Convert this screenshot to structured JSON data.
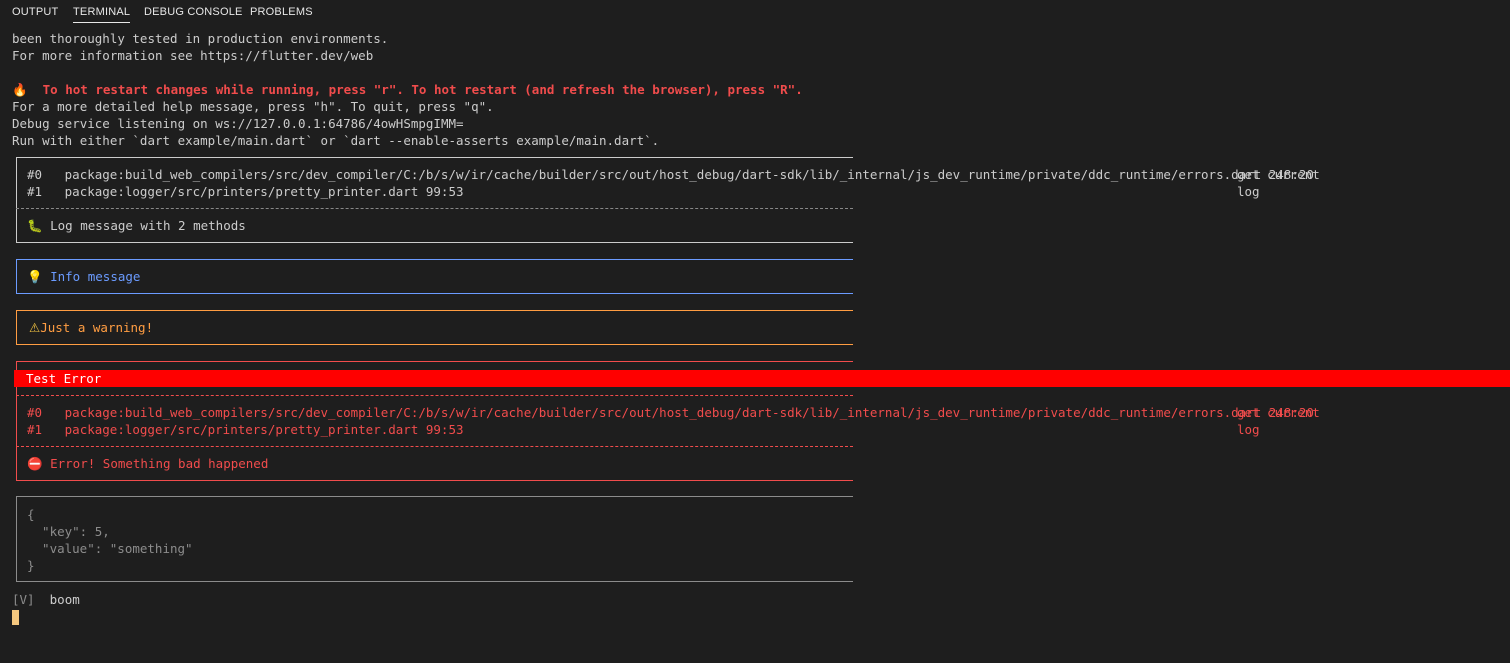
{
  "tabs": [
    {
      "label": "OUTPUT",
      "active": false
    },
    {
      "label": "TERMINAL",
      "active": true
    },
    {
      "label": "DEBUG CONSOLE",
      "active": false
    },
    {
      "label": "PROBLEMS",
      "active": false
    }
  ],
  "terminal": {
    "intro": [
      "been thoroughly tested in production environments.",
      "For more information see https://flutter.dev/web"
    ],
    "hot_restart": "To hot restart changes while running, press \"r\". To hot restart (and refresh the browser), press \"R\".",
    "help_lines": [
      "For a more detailed help message, press \"h\". To quit, press \"q\".",
      "Debug service listening on ws://127.0.0.1:64786/4owHSmpgIMM=",
      "Run with either `dart example/main.dart` or `dart --enable-asserts example/main.dart`."
    ],
    "debug_box": {
      "frames": [
        {
          "num": "#0",
          "path": "package:build_web_compilers/src/dev_compiler/C:/b/s/w/ir/cache/builder/src/out/host_debug/dart-sdk/lib/_internal/js_dev_runtime/private/ddc_runtime/errors.dart 248:20",
          "fn": "get current"
        },
        {
          "num": "#1",
          "path": "package:logger/src/printers/pretty_printer.dart 99:53",
          "fn": "log"
        }
      ],
      "message": "Log message with 2 methods"
    },
    "info_box": {
      "message": "Info message"
    },
    "warning_box": {
      "message": "Just a warning!"
    },
    "error_box": {
      "title": "Test Error",
      "frames": [
        {
          "num": "#0",
          "path": "package:build_web_compilers/src/dev_compiler/C:/b/s/w/ir/cache/builder/src/out/host_debug/dart-sdk/lib/_internal/js_dev_runtime/private/ddc_runtime/errors.dart 248:20",
          "fn": "get current"
        },
        {
          "num": "#1",
          "path": "package:logger/src/printers/pretty_printer.dart 99:53",
          "fn": "log"
        }
      ],
      "message": "Error! Something bad happened"
    },
    "json_box": {
      "lines": [
        "{",
        "  \"key\": 5,",
        "  \"value\": \"something\"",
        "}"
      ]
    },
    "verbose": {
      "prefix": "[V]",
      "message": "boom"
    }
  },
  "colors": {
    "background": "#1e1e1e",
    "text": "#cccccc",
    "error": "#f14c4c",
    "info": "#6b9bff",
    "warning": "#ff9d42",
    "json": "#8c8c8c",
    "error_bar": "#ff0000",
    "cursor": "#f5c77e"
  },
  "icons": {
    "hot_restart": "fire-icon",
    "debug": "bug-icon",
    "info": "lightbulb-icon",
    "warning": "warning-icon",
    "error": "no-entry-icon"
  }
}
